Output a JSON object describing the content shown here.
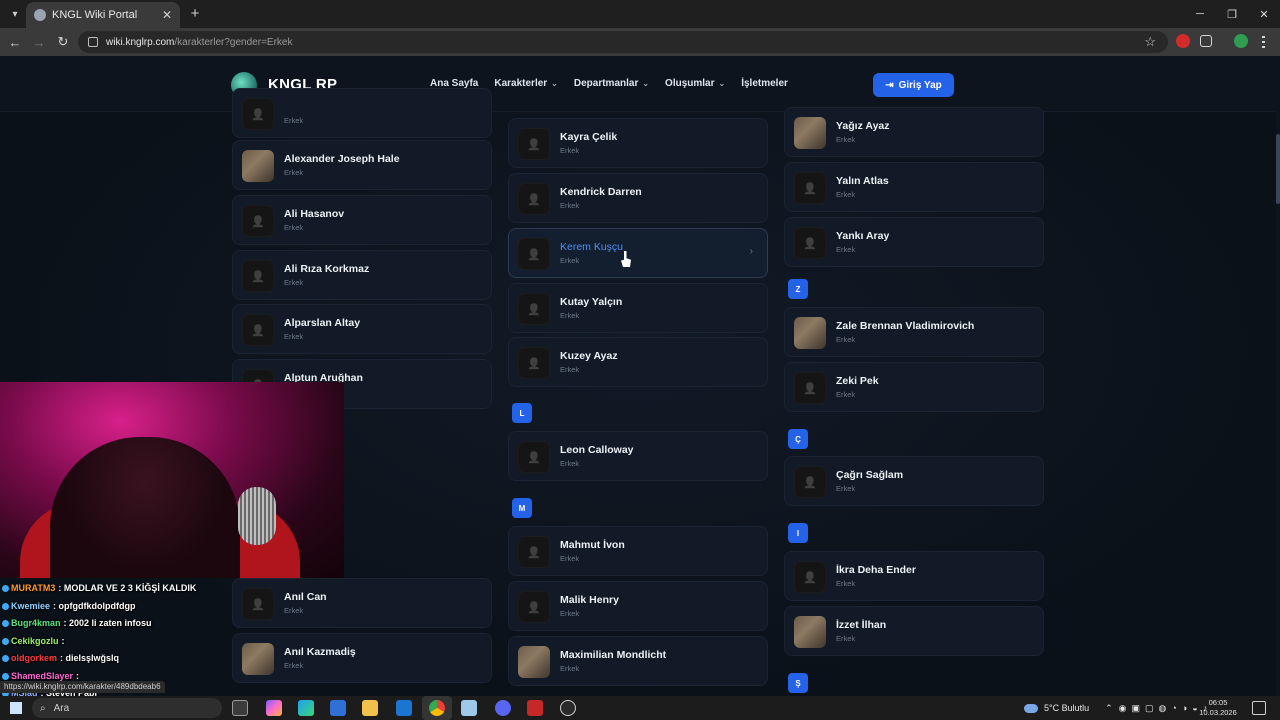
{
  "browser": {
    "tab_title": "KNGL Wiki Portal",
    "url_host": "wiki.knglrp.com",
    "url_path": "/karakterler?gender=Erkek"
  },
  "site": {
    "brand": "KNGL RP",
    "nav": [
      "Ana Sayfa",
      "Karakterler",
      "Departmanlar",
      "Oluşumlar",
      "İşletmeler"
    ],
    "login_label": "Giriş Yap",
    "accent": "#2462e8"
  },
  "columns": {
    "col1": [
      {
        "name": "",
        "sub": "Erkek"
      },
      {
        "name": "Alexander Joseph Hale",
        "sub": "Erkek",
        "photo": true
      },
      {
        "name": "Ali Hasanov",
        "sub": "Erkek"
      },
      {
        "name": "Ali Rıza Korkmaz",
        "sub": "Erkek"
      },
      {
        "name": "Alparslan Altay",
        "sub": "Erkek"
      },
      {
        "name": "Alptun Aruğhan",
        "sub": "Erkek"
      },
      {
        "name": "Anıl Can",
        "sub": "Erkek"
      },
      {
        "name": "Anıl Kazmadiş",
        "sub": "Erkek",
        "photo": true
      }
    ],
    "col2": [
      {
        "name": "Kayra Çelik",
        "sub": "Erkek"
      },
      {
        "name": "Kendrick Darren",
        "sub": "Erkek"
      },
      {
        "name": "Kerem Kuşçu",
        "sub": "Erkek",
        "hover": true
      },
      {
        "name": "Kutay Yalçın",
        "sub": "Erkek"
      },
      {
        "name": "Kuzey Ayaz",
        "sub": "Erkek"
      },
      {
        "letter": "L"
      },
      {
        "name": "Leon Calloway",
        "sub": "Erkek"
      },
      {
        "letter": "M"
      },
      {
        "name": "Mahmut İvon",
        "sub": "Erkek"
      },
      {
        "name": "Malik Henry",
        "sub": "Erkek"
      },
      {
        "name": "Maximilian Mondlicht",
        "sub": "Erkek",
        "photo": true
      }
    ],
    "col3": [
      {
        "name": "Yağız Ayaz",
        "sub": "Erkek",
        "photo": true
      },
      {
        "name": "Yalın Atlas",
        "sub": "Erkek"
      },
      {
        "name": "Yankı Aray",
        "sub": "Erkek"
      },
      {
        "letter": "Z"
      },
      {
        "name": "Zale Brennan Vladimirovich",
        "sub": "Erkek",
        "photo": true
      },
      {
        "name": "Zeki Pek",
        "sub": "Erkek"
      },
      {
        "letter": "Ç"
      },
      {
        "name": "Çağrı Sağlam",
        "sub": "Erkek"
      },
      {
        "letter": "I"
      },
      {
        "name": "İkra Deha Ender",
        "sub": "Erkek"
      },
      {
        "name": "İzzet İlhan",
        "sub": "Erkek",
        "photo": true
      },
      {
        "letter": "Ş"
      }
    ]
  },
  "chat": [
    {
      "user": "MURATM3",
      "color": "#ff9a2e",
      "msg": "MODLAR VE 2 3 KİĞŞİ KALDIK"
    },
    {
      "user": "Kwemiee",
      "color": "#8fd3ff",
      "msg": "opfgdfkdolpdfdgp"
    },
    {
      "user": "Bugr4kman",
      "color": "#5be37a",
      "msg": "2002 li zaten infosu"
    },
    {
      "user": "Cekikgozlu",
      "color": "#9ef06a",
      "msg": ""
    },
    {
      "user": "oldgorkem",
      "color": "#ff3b3b",
      "msg": "dielsşlwğslq"
    },
    {
      "user": "ShamedSlayer",
      "color": "#ff6ad5",
      "msg": ""
    },
    {
      "user": "MSlad",
      "color": "#8fb3ff",
      "msg": "Steven Papi"
    }
  ],
  "status_url": "https://wiki.knglrp.com/karakter/489dbdeab6",
  "taskbar": {
    "search_placeholder": "Ara",
    "weather": "5°C  Bulutlu",
    "time": "06:05",
    "date": "10.03.2026"
  }
}
